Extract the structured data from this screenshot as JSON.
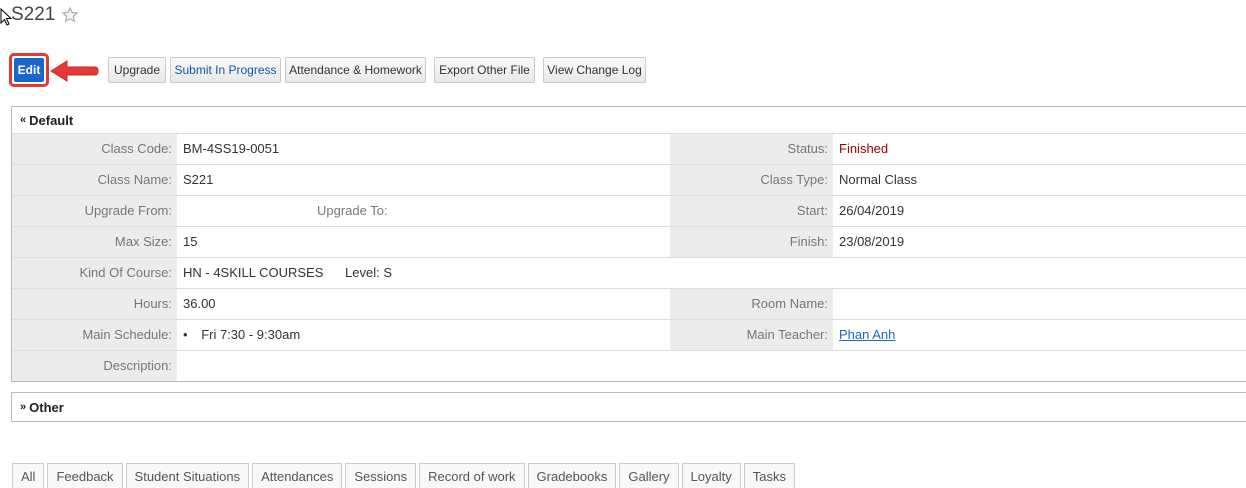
{
  "page": {
    "title": "S221"
  },
  "toolbar": {
    "edit": "Edit",
    "buttons": [
      "Upgrade",
      "Submit In Progress",
      "Attendance & Homework",
      "Export Other File",
      "View Change Log"
    ]
  },
  "sections": {
    "default": "Default",
    "other": "Other"
  },
  "fields": {
    "class_code": {
      "label": "Class Code:",
      "value": "BM-4SS19-0051"
    },
    "status": {
      "label": "Status:",
      "value": "Finished"
    },
    "class_name": {
      "label": "Class Name:",
      "value": "S221"
    },
    "class_type": {
      "label": "Class Type:",
      "value": "Normal Class"
    },
    "upgrade_from": {
      "label": "Upgrade From:",
      "value": ""
    },
    "upgrade_to": {
      "label": "Upgrade To:",
      "value": ""
    },
    "start": {
      "label": "Start:",
      "value": "26/04/2019"
    },
    "max_size": {
      "label": "Max Size:",
      "value": "15"
    },
    "finish": {
      "label": "Finish:",
      "value": "23/08/2019"
    },
    "kind_of_course": {
      "label": "Kind Of Course:",
      "value": "HN - 4SKILL COURSES"
    },
    "level": {
      "label": "Level:",
      "value": "S"
    },
    "hours": {
      "label": "Hours:",
      "value": "36.00"
    },
    "room_name": {
      "label": "Room Name:",
      "value": ""
    },
    "main_schedule": {
      "label": "Main Schedule:",
      "value": "Fri 7:30 - 9:30am"
    },
    "main_teacher": {
      "label": "Main Teacher:",
      "value": "Phan Anh"
    },
    "description": {
      "label": "Description:",
      "value": ""
    }
  },
  "tabs": [
    "All",
    "Feedback",
    "Student Situations",
    "Attendances",
    "Sessions",
    "Record of work",
    "Gradebooks",
    "Gallery",
    "Loyalty",
    "Tasks"
  ],
  "colors": {
    "edit_button": "#1a66c9",
    "highlight": "#e53935",
    "status_finished": "#a00000",
    "label_bg": "#ececec"
  }
}
